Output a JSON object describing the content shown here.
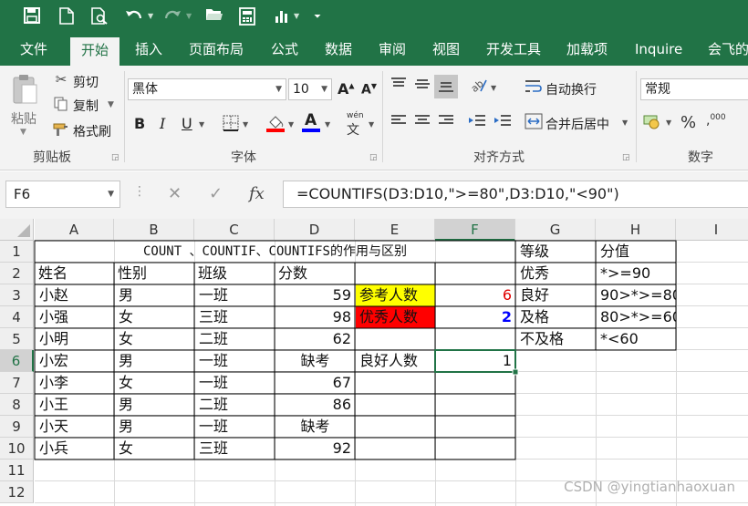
{
  "colors": {
    "excel_green": "#217346",
    "yellow_fill": "#ffff00",
    "red_fill": "#ff0000",
    "red_text": "#e00000",
    "blue_text": "#0000ff"
  },
  "qat": {
    "icons": [
      "save-icon",
      "new-file-icon",
      "print-preview-icon",
      "undo-icon",
      "redo-icon",
      "open-folder-icon",
      "calculator-icon",
      "chart-icon",
      "customize-icon"
    ]
  },
  "tabs": [
    "文件",
    "开始",
    "插入",
    "页面布局",
    "公式",
    "数据",
    "审阅",
    "视图",
    "开发工具",
    "加载项",
    "Inquire",
    "会飞的"
  ],
  "ribbon": {
    "clipboard": {
      "paste": "粘贴",
      "cut": "剪切",
      "copy": "复制",
      "format_painter": "格式刷",
      "label": "剪贴板"
    },
    "font": {
      "name": "黑体",
      "size": "10",
      "label": "字体",
      "bold": "B",
      "italic": "I",
      "underline": "U",
      "grow": "A",
      "shrink": "A",
      "color_letter": "A",
      "phonetic": "wén"
    },
    "alignment": {
      "wrap_text": "自动换行",
      "merge_center": "合并后居中",
      "label": "对齐方式"
    },
    "number": {
      "format": "常规",
      "label": "数字",
      "percent": "%"
    }
  },
  "formula_bar": {
    "name_box": "F6",
    "formula": "=COUNTIFS(D3:D10,\">=80\",D3:D10,\"<90\")",
    "cancel": "✕",
    "enter": "✓",
    "fx": "fx"
  },
  "sheet": {
    "columns": [
      "A",
      "B",
      "C",
      "D",
      "E",
      "F",
      "G",
      "H",
      "I"
    ],
    "rows": [
      "1",
      "2",
      "3",
      "4",
      "5",
      "6",
      "7",
      "8",
      "9",
      "10",
      "11",
      "12"
    ],
    "title": "COUNT 、COUNTIF、COUNTIFS的作用与区别",
    "headers": [
      "姓名",
      "性别",
      "班级",
      "分数"
    ],
    "records": [
      [
        "小赵",
        "男",
        "一班",
        "59"
      ],
      [
        "小强",
        "女",
        "三班",
        "98"
      ],
      [
        "小明",
        "女",
        "二班",
        "62"
      ],
      [
        "小宏",
        "男",
        "一班",
        "缺考"
      ],
      [
        "小李",
        "女",
        "一班",
        "67"
      ],
      [
        "小王",
        "男",
        "二班",
        "86"
      ],
      [
        "小天",
        "男",
        "一班",
        "缺考"
      ],
      [
        "小兵",
        "女",
        "三班",
        "92"
      ]
    ],
    "stats": [
      {
        "label": "参考人数",
        "value": "6"
      },
      {
        "label": "优秀人数",
        "value": "2"
      },
      {
        "label": "良好人数",
        "value": "1"
      }
    ],
    "grades": {
      "header": [
        "等级",
        "分值"
      ],
      "rows": [
        [
          "优秀",
          "*>=90"
        ],
        [
          "良好",
          "90>*>=80"
        ],
        [
          "及格",
          "80>*>=60"
        ],
        [
          "不及格",
          "*<60"
        ]
      ]
    }
  },
  "watermark": "CSDN @yingtianhaoxuan"
}
